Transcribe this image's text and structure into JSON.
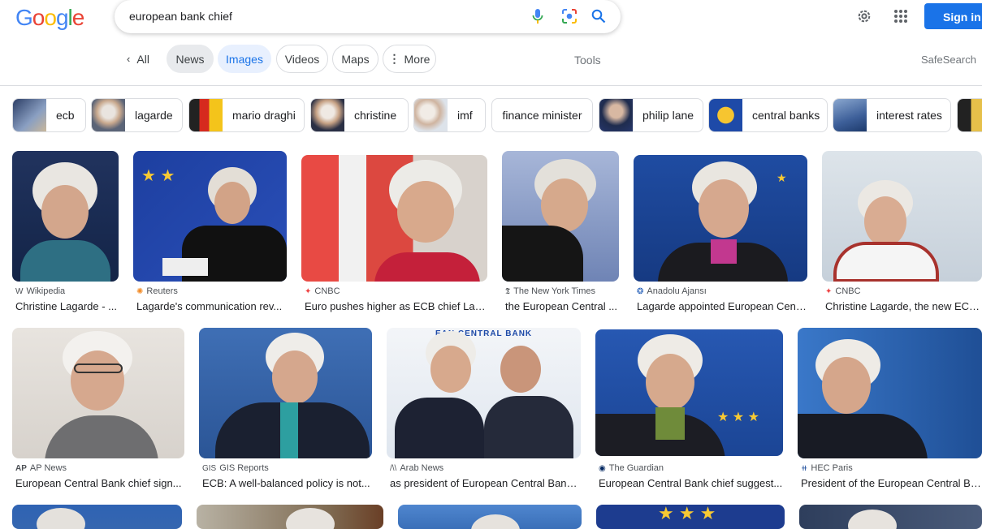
{
  "logo": "Google",
  "search": {
    "value": "european bank chief"
  },
  "header": {
    "sign_in": "Sign in"
  },
  "tabs": [
    {
      "label": "All"
    },
    {
      "label": "News"
    },
    {
      "label": "Images"
    },
    {
      "label": "Videos"
    },
    {
      "label": "Maps"
    },
    {
      "label": "More"
    }
  ],
  "tools": "Tools",
  "safesearch": "SafeSearch",
  "chips": [
    {
      "label": "ecb"
    },
    {
      "label": "lagarde"
    },
    {
      "label": "mario draghi"
    },
    {
      "label": "christine"
    },
    {
      "label": "imf"
    },
    {
      "label": "finance minister"
    },
    {
      "label": "philip lane"
    },
    {
      "label": "central banks"
    },
    {
      "label": "interest rates"
    }
  ],
  "results": [
    {
      "source": "Wikipedia",
      "title": "Christine Lagarde - ..."
    },
    {
      "source": "Reuters",
      "title": "Lagarde's communication rev..."
    },
    {
      "source": "CNBC",
      "title": "Euro pushes higher as ECB chief Lag..."
    },
    {
      "source": "The New York Times",
      "title": "the European Central ..."
    },
    {
      "source": "Anadolu Ajansı",
      "title": "Lagarde appointed European Cent..."
    },
    {
      "source": "CNBC",
      "title": "Christine Lagarde, the new ECB ..."
    },
    {
      "source": "AP News",
      "title": "European Central Bank chief sign..."
    },
    {
      "source": "GIS Reports",
      "title": "ECB: A well-balanced policy is not..."
    },
    {
      "source": "Arab News",
      "title": "as president of European Central Bank ..."
    },
    {
      "source": "The Guardian",
      "title": "European Central Bank chief suggest..."
    },
    {
      "source": "HEC Paris",
      "title": "President of the European Central Ban..."
    }
  ],
  "colors": {
    "accent": "#1a73e8",
    "border": "#dadce0"
  }
}
